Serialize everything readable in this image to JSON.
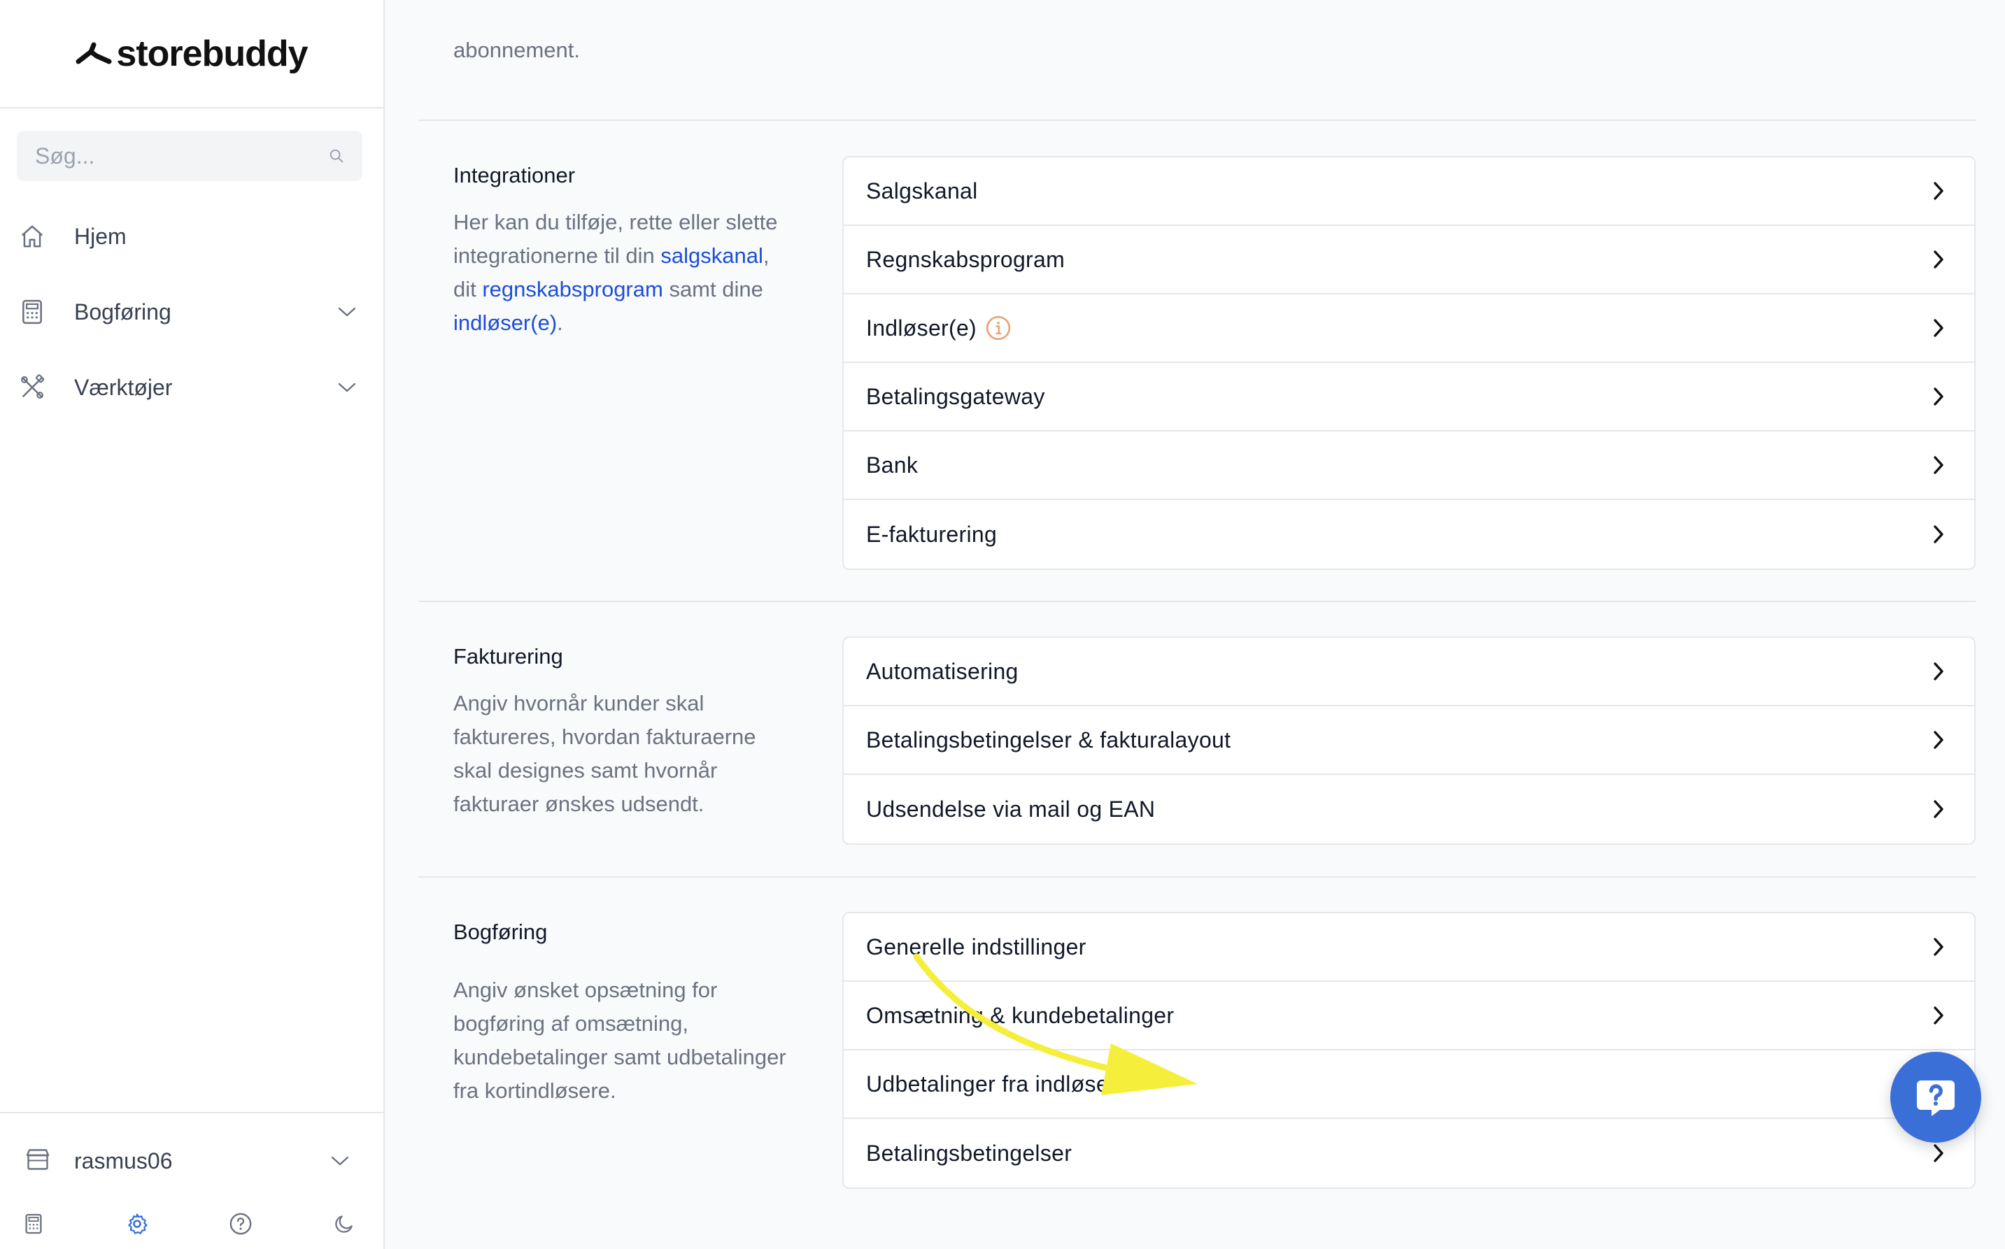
{
  "brand": {
    "name": "storebuddy"
  },
  "search": {
    "placeholder": "Søg..."
  },
  "nav": [
    {
      "label": "Hjem",
      "icon": "home-icon"
    },
    {
      "label": "Bogføring",
      "icon": "calculator-icon",
      "expandable": true
    },
    {
      "label": "Værktøjer",
      "icon": "tools-icon",
      "expandable": true
    }
  ],
  "account": {
    "name": "rasmus06"
  },
  "footer_icons": [
    "calculator-icon",
    "gear-icon",
    "help-icon",
    "moon-icon"
  ],
  "main": {
    "top_text": "abonnement.",
    "sections": [
      {
        "title": "Integrationer",
        "desc_parts": [
          "Her kan du tilføje, rette eller slette integrationerne til din ",
          "salgskanal",
          ", dit ",
          "regnskabsprogram",
          " samt dine ",
          "indløser(e)",
          "."
        ],
        "rows": [
          "Salgskanal",
          "Regnskabsprogram",
          "Indløser(e)",
          "Betalingsgateway",
          "Bank",
          "E-fakturering"
        ]
      },
      {
        "title": "Fakturering",
        "desc": "Angiv hvornår kunder skal faktureres, hvordan fakturaerne skal designes samt hvornår fakturaer ønskes udsendt.",
        "rows": [
          "Automatisering",
          "Betalingsbetingelser & fakturalayout",
          "Udsendelse via mail og EAN"
        ]
      },
      {
        "title": "Bogføring",
        "desc": "Angiv ønsket opsætning for bogføring af omsætning, kundebetalinger samt udbetalinger fra kortindløsere.",
        "rows": [
          "Generelle indstillinger",
          "Omsætning & kundebetalinger",
          "Udbetalinger fra indløsere",
          "Betalingsbetingelser"
        ]
      }
    ]
  },
  "colors": {
    "link": "#1d4ed8",
    "accent": "#3b6fd8",
    "arrow": "#f5ef3b",
    "info": "#e8a27a"
  }
}
